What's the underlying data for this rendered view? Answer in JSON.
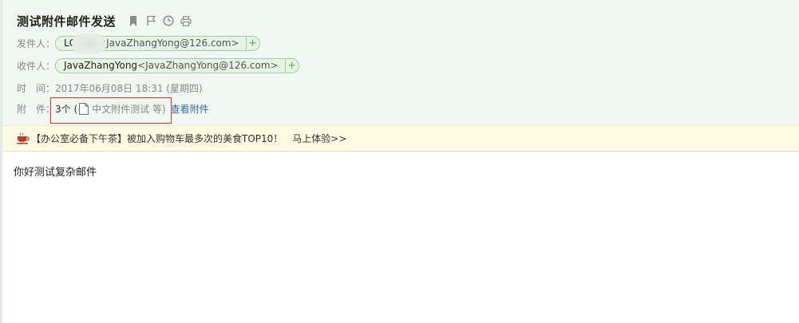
{
  "mail": {
    "subject": "测试附件邮件发送",
    "icons": [
      "bookmark-icon",
      "flag-icon",
      "clock-icon",
      "print-icon"
    ],
    "from": {
      "label": "发件人：",
      "name": "LC",
      "email": "<JavaZhangYong@126.com>",
      "add_label": "+"
    },
    "to": {
      "label": "收件人：",
      "name": "JavaZhangYong",
      "email": "<JavaZhangYong@126.com>",
      "add_label": "+"
    },
    "time": {
      "label": "时　间：",
      "value": "2017年06月08日 18:31 (星期四)"
    },
    "attachment": {
      "label": "附　件：",
      "count": "3个 (",
      "file_name": "中文附件测试 等)",
      "view_link": "查看附件"
    }
  },
  "ad": {
    "text": "【办公室必备下午茶】被加入购物车最多次的美食TOP10！",
    "link": "马上体验>>"
  },
  "body": {
    "text": "你好测试复杂邮件"
  },
  "colors": {
    "header_bg": "#f1f7f1",
    "chip_bg": "#e6f3e6",
    "chip_border": "#9fcf9f",
    "ad_bg": "#fffbe2",
    "highlight": "#e03030",
    "link": "#2c6fad"
  }
}
